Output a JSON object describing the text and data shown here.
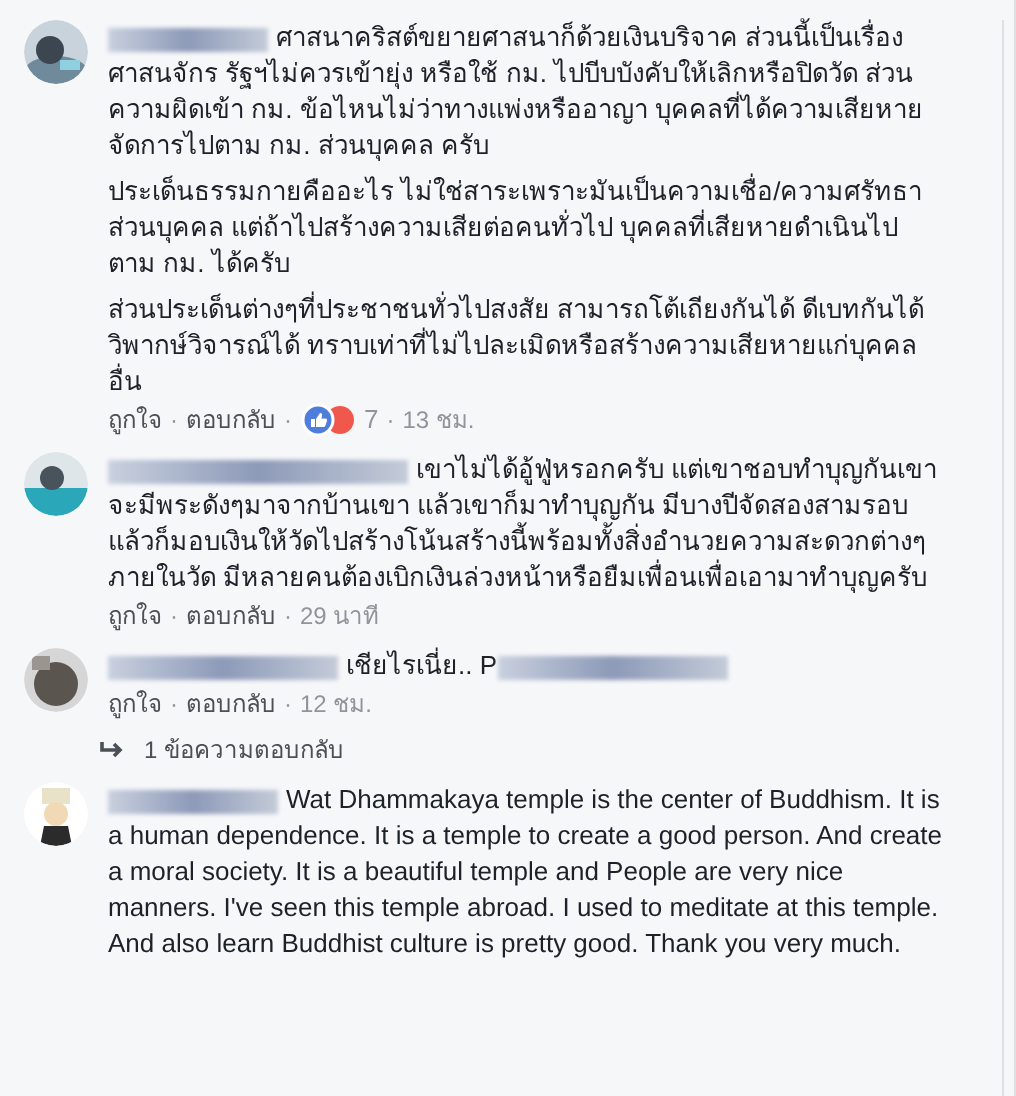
{
  "comments": [
    {
      "paragraphs": [
        "ศาสนาคริสต์ขยายศาสนาก็ด้วยเงินบริจาค ส่วนนี้เป็นเรื่องศาสนจักร รัฐฯไม่ควรเข้ายุ่ง หรือใช้ กม. ไปบีบบังคับให้เลิกหรือปิดวัด ส่วนความผิดเข้า กม. ข้อไหนไม่ว่าทางแพ่งหรืออาญา บุคคลที่ได้ความเสียหายจัดการไปตาม กม. ส่วนบุคคล ครับ",
        "ประเด็นธรรมกายคืออะไร ไม่ใช่สาระเพราะมันเป็นความเชื่อ/ความศรัทธาส่วนบุคคล แต่ถ้าไปสร้างความเสียต่อคนทั่วไป บุคคลที่เสียหายดำเนินไปตาม กม. ได้ครับ",
        "ส่วนประเด็นต่างๆที่ประชาชนทั่วไปสงสัย สามารถโต้เถียงกันได้ ดีเบทกันได้วิพากษ์วิจารณ์ได้ ทราบเท่าที่ไม่ไปละเมิดหรือสร้างความเสียหายแก่บุคคลอื่น"
      ],
      "actions": [
        {
          "kind": "link",
          "text": "ถูกใจ"
        },
        {
          "kind": "dot",
          "text": "·"
        },
        {
          "kind": "link",
          "text": "ตอบกลับ"
        },
        {
          "kind": "dot",
          "text": "·"
        },
        {
          "kind": "reactions",
          "text": "7"
        },
        {
          "kind": "dot",
          "text": "·"
        },
        {
          "kind": "time",
          "text": "13 ชม."
        }
      ]
    },
    {
      "paragraphs": [
        "เขาไม่ได้อู้ฟู่หรอกครับ แต่เขาชอบทำบุญกันเขาจะมีพระดังๆมาจากบ้านเขา แล้วเขาก็มาทำบุญกัน มีบางปีจัดสองสามรอบ แล้วก็มอบเงินให้วัดไปสร้างโน้นสร้างนี้พร้อมทั้งสิ่งอำนวยความสะดวกต่างๆภายในวัด มีหลายคนต้องเบิกเงินล่วงหน้าหรือยืมเพื่อนเพื่อเอามาทำบุญครับ"
      ],
      "actions": [
        {
          "kind": "link",
          "text": "ถูกใจ"
        },
        {
          "kind": "dot",
          "text": "·"
        },
        {
          "kind": "link",
          "text": "ตอบกลับ"
        },
        {
          "kind": "dot",
          "text": "·"
        },
        {
          "kind": "time",
          "text": "29 นาที"
        }
      ]
    },
    {
      "paragraphs": [
        "เชียไรเนี่ย.. P"
      ],
      "trailing_blur": true,
      "actions": [
        {
          "kind": "link",
          "text": "ถูกใจ"
        },
        {
          "kind": "dot",
          "text": "·"
        },
        {
          "kind": "link",
          "text": "ตอบกลับ"
        },
        {
          "kind": "dot",
          "text": "·"
        },
        {
          "kind": "time",
          "text": "12 ชม."
        }
      ],
      "replies_link": "1 ข้อความตอบกลับ"
    },
    {
      "paragraphs": [
        "Wat Dhammakaya temple is the center of Buddhism. It is a human dependence. It is a temple to create a good person. And create a moral society. It is a beautiful temple and People are very nice manners. I've seen this temple abroad. I used to meditate at this temple. And also learn Buddhist culture is pretty good. Thank you very much."
      ]
    }
  ]
}
